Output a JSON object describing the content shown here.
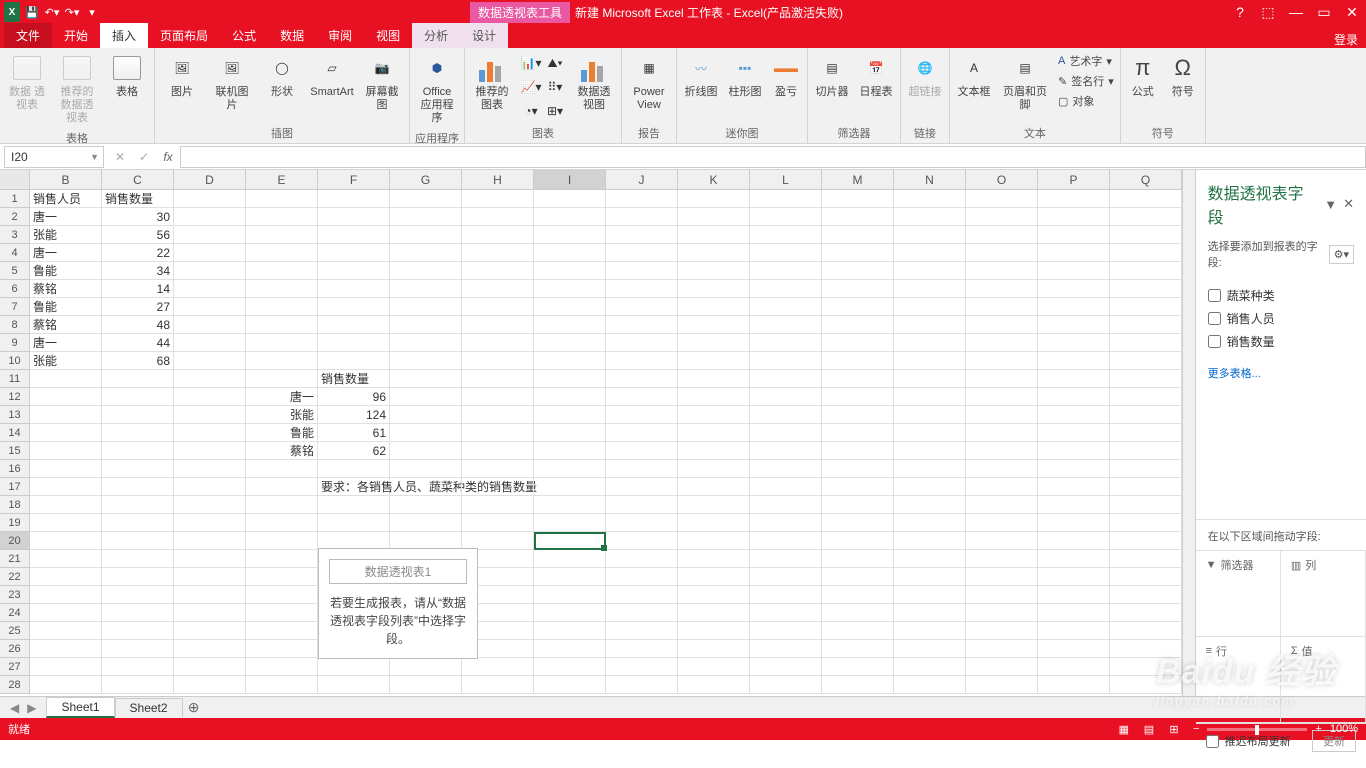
{
  "title": {
    "context_tab": "数据透视表工具",
    "doc": "新建 Microsoft Excel 工作表 -  Excel(产品激活失败)"
  },
  "tabs": {
    "file": "文件",
    "home": "开始",
    "insert": "插入",
    "layout": "页面布局",
    "formulas": "公式",
    "data": "数据",
    "review": "审阅",
    "view": "视图",
    "analyze": "分析",
    "design": "设计",
    "login": "登录"
  },
  "ribbon": {
    "g_tables": "表格",
    "pivot": "数据\n透视表",
    "rec_pivot": "推荐的\n数据透视表",
    "table": "表格",
    "g_illus": "插图",
    "picture": "图片",
    "online_pic": "联机图片",
    "shapes": "形状",
    "smartart": "SmartArt",
    "screenshot": "屏幕截图",
    "g_apps": "应用程序",
    "office_apps": "Office\n应用程序",
    "g_charts": "图表",
    "rec_charts": "推荐的\n图表",
    "pivot_chart": "数据透视图",
    "g_reports": "报告",
    "powerview": "Power\nView",
    "g_spark": "迷你图",
    "spark_line": "折线图",
    "spark_col": "柱形图",
    "spark_wl": "盈亏",
    "g_filter": "筛选器",
    "slicer": "切片器",
    "timeline": "日程表",
    "g_links": "链接",
    "hyperlink": "超链接",
    "g_text": "文本",
    "textbox": "文本框",
    "headerfooter": "页眉和页脚",
    "wordart": "艺术字",
    "sigline": "签名行",
    "object": "对象",
    "g_symbols": "符号",
    "equation": "公式",
    "symbol": "符号"
  },
  "namebox": "I20",
  "columns": [
    "B",
    "C",
    "D",
    "E",
    "F",
    "G",
    "H",
    "I",
    "J",
    "K",
    "L",
    "M",
    "N",
    "O",
    "P",
    "Q"
  ],
  "sheet": {
    "headers": [
      "销售人员",
      "销售数量"
    ],
    "rows": [
      [
        "唐一",
        "30"
      ],
      [
        "张能",
        "56"
      ],
      [
        "唐一",
        "22"
      ],
      [
        "鲁能",
        "34"
      ],
      [
        "蔡铭",
        "14"
      ],
      [
        "鲁能",
        "27"
      ],
      [
        "蔡铭",
        "48"
      ],
      [
        "唐一",
        "44"
      ],
      [
        "张能",
        "68"
      ]
    ],
    "summary_hdr": "销售数量",
    "summary": [
      [
        "唐一",
        "96"
      ],
      [
        "张能",
        "124"
      ],
      [
        "鲁能",
        "61"
      ],
      [
        "蔡铭",
        "62"
      ]
    ],
    "requirement": "要求：各销售人员、蔬菜种类的销售数量"
  },
  "pivot_ph": {
    "title": "数据透视表1",
    "text": "若要生成报表，请从“数据透视表字段列表”中选择字段。"
  },
  "pane": {
    "title": "数据透视表字段",
    "choose": "选择要添加到报表的字段:",
    "fields": [
      "蔬菜种类",
      "销售人员",
      "销售数量"
    ],
    "more": "更多表格...",
    "drag": "在以下区域间拖动字段:",
    "filters": "筛选器",
    "cols": "列",
    "rows": "行",
    "values": "值",
    "defer": "推迟布局更新",
    "update": "更新"
  },
  "sheets": {
    "s1": "Sheet1",
    "s2": "Sheet2"
  },
  "status": {
    "ready": "就绪",
    "zoom": "100%"
  },
  "watermark": {
    "main": "Baidu 经验",
    "sub": "jingyan.baidu.com"
  }
}
